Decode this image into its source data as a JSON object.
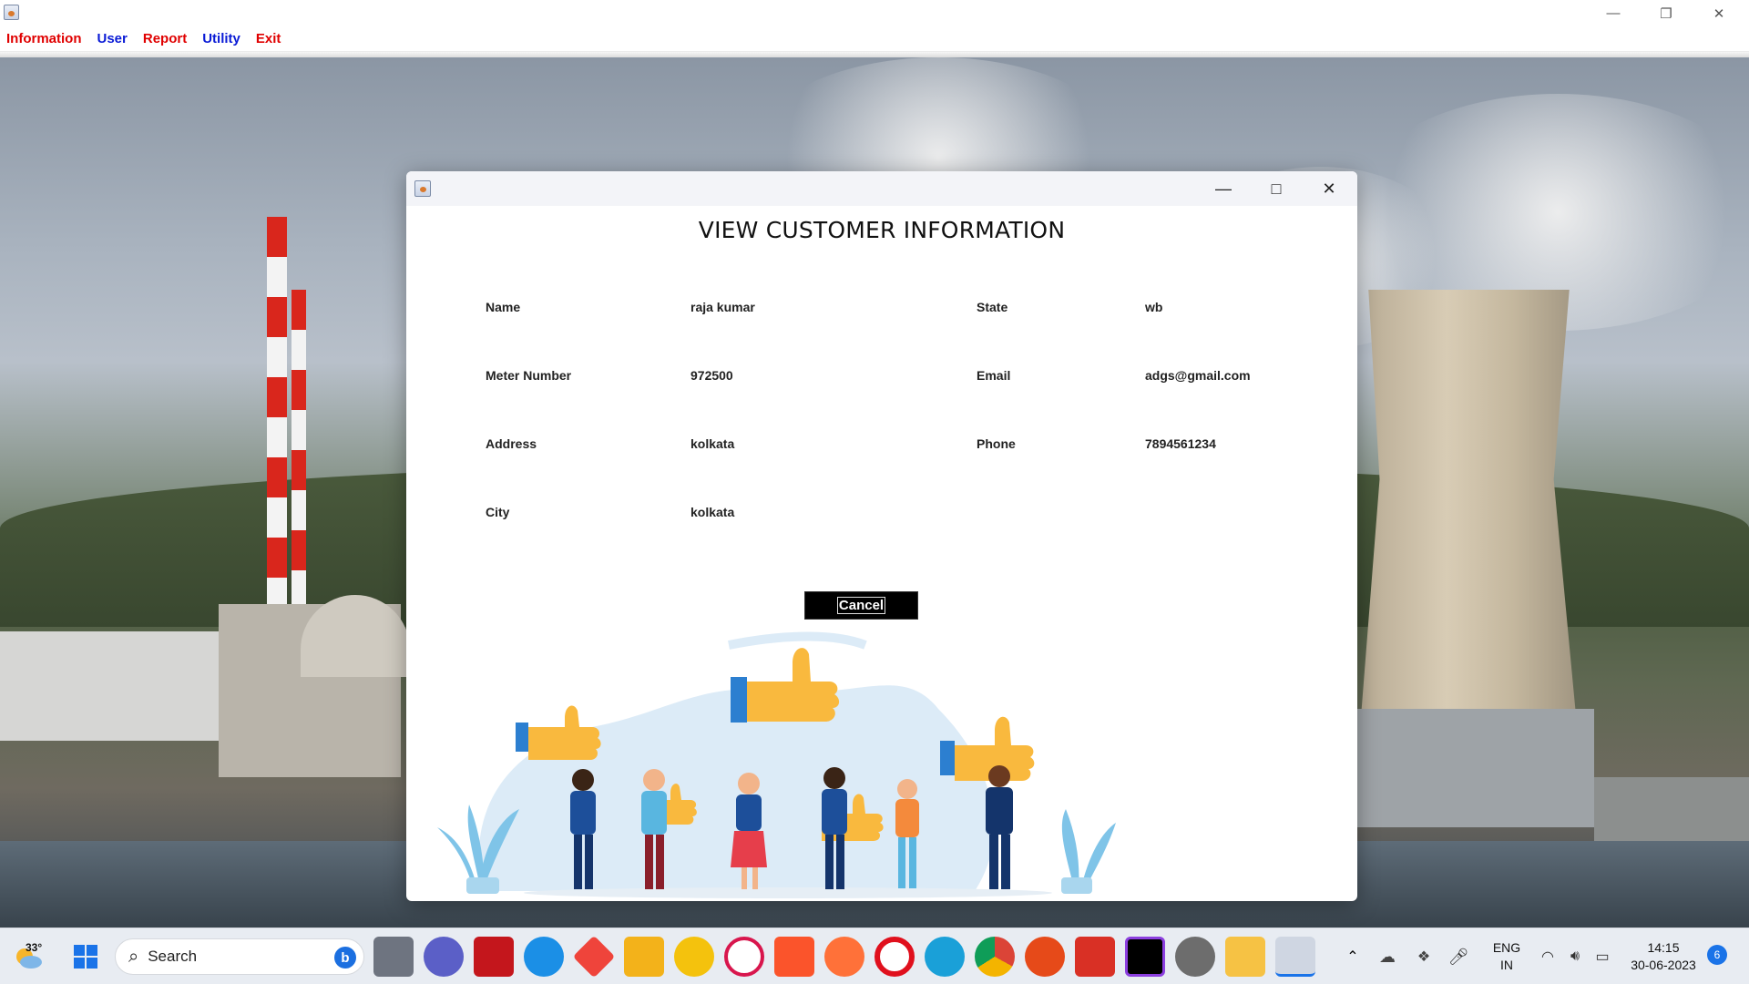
{
  "app": {
    "menu": [
      {
        "label": "Information",
        "color": "#e00000"
      },
      {
        "label": "User",
        "color": "#0a1bd6"
      },
      {
        "label": "Report",
        "color": "#e00000"
      },
      {
        "label": "Utility",
        "color": "#0a1bd6"
      },
      {
        "label": "Exit",
        "color": "#e00000"
      }
    ]
  },
  "dialog": {
    "title": "VIEW CUSTOMER INFORMATION",
    "fields": {
      "name": {
        "label": "Name",
        "value": "raja kumar"
      },
      "meter": {
        "label": "Meter Number",
        "value": "972500"
      },
      "address": {
        "label": "Address",
        "value": "kolkata"
      },
      "city": {
        "label": "City",
        "value": "kolkata"
      },
      "state": {
        "label": "State",
        "value": "wb"
      },
      "email": {
        "label": "Email",
        "value": "adgs@gmail.com"
      },
      "phone": {
        "label": "Phone",
        "value": "7894561234"
      }
    },
    "cancel_label": "Cancel"
  },
  "taskbar": {
    "weather": "33°",
    "search_label": "Search",
    "lang_line1": "ENG",
    "lang_line2": "IN",
    "time": "14:15",
    "date": "30-06-2023",
    "notification_count": "6",
    "apps": [
      "windows-start",
      "bing",
      "task-view",
      "zoom",
      "mcafee",
      "help",
      "anydesk",
      "microsoft-store",
      "norton",
      "opera-gx",
      "brave",
      "firefox",
      "opera",
      "edge",
      "chrome",
      "sublime",
      "scala",
      "intellij",
      "settings",
      "file-explorer",
      "java"
    ]
  }
}
